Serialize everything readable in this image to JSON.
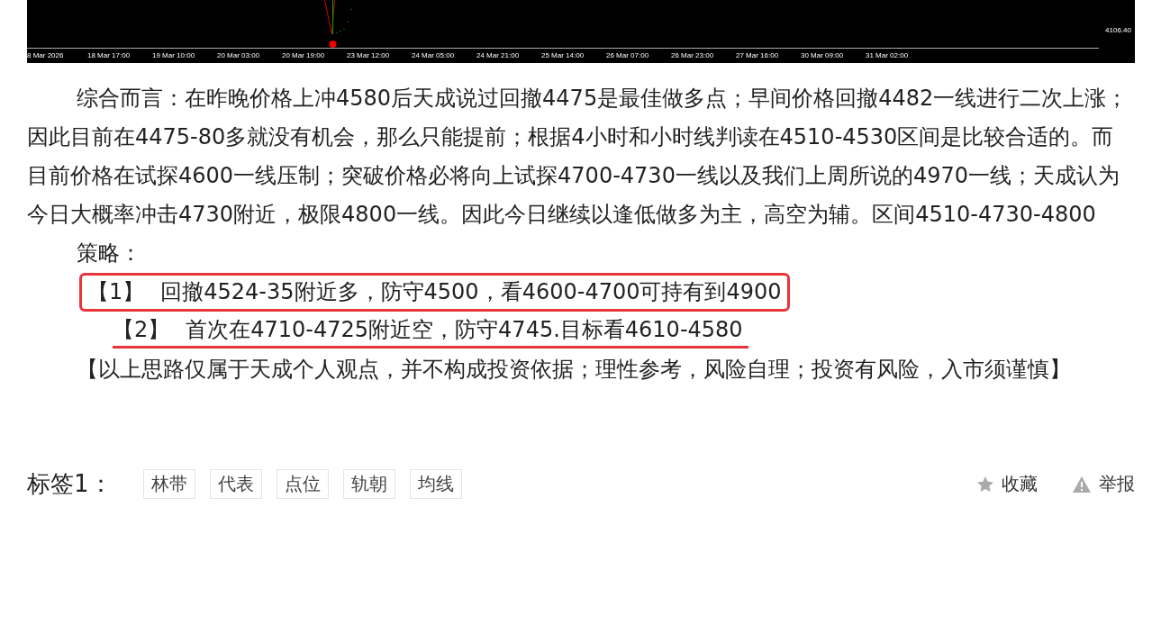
{
  "chart": {
    "x_labels": [
      "8 Mar 2026",
      "18 Mar 17:00",
      "19 Mar 10:00",
      "20 Mar 03:00",
      "20 Mar 19:00",
      "23 Mar 12:00",
      "24 Mar 05:00",
      "24 Mar 21:00",
      "25 Mar 14:00",
      "26 Mar 07:00",
      "26 Mar 23:00",
      "27 Mar 16:00",
      "30 Mar 09:00",
      "31 Mar 02:00"
    ],
    "price_label": "4106.40"
  },
  "summary": "综合而言：在昨晚价格上冲4580后天成说过回撤4475是最佳做多点；早间价格回撤4482一线进行二次上涨；因此目前在4475-80多就没有机会，那么只能提前；根据4小时和小时线判读在4510-4530区间是比较合适的。而目前价格在试探4600一线压制；突破价格必将向上试探4700-4730一线以及我们上周所说的4970一线；天成认为今日大概率冲击4730附近，极限4800一线。因此今日继续以逢低做多为主，高空为辅。区间4510-4730-4800",
  "strategy_heading": "策略：",
  "strategies": [
    {
      "index": "【1】",
      "text": "回撤4524-35附近多，防守4500，看4600-4700可持有到4900",
      "kind": "boxed"
    },
    {
      "index": "【2】",
      "text": "首次在4710-4725附近空，防守4745.目标看4610-4580",
      "kind": "underlined"
    }
  ],
  "disclaimer": "【以上思路仅属于天成个人观点，并不构成投资依据；理性参考，风险自理；投资有风险，入市须谨慎】",
  "tags": {
    "label": "标签1：",
    "items": [
      "林带",
      "代表",
      "点位",
      "轨朝",
      "均线"
    ]
  },
  "actions": [
    {
      "label": "收藏",
      "kind": "favorite"
    },
    {
      "label": "举报",
      "kind": "report"
    }
  ]
}
